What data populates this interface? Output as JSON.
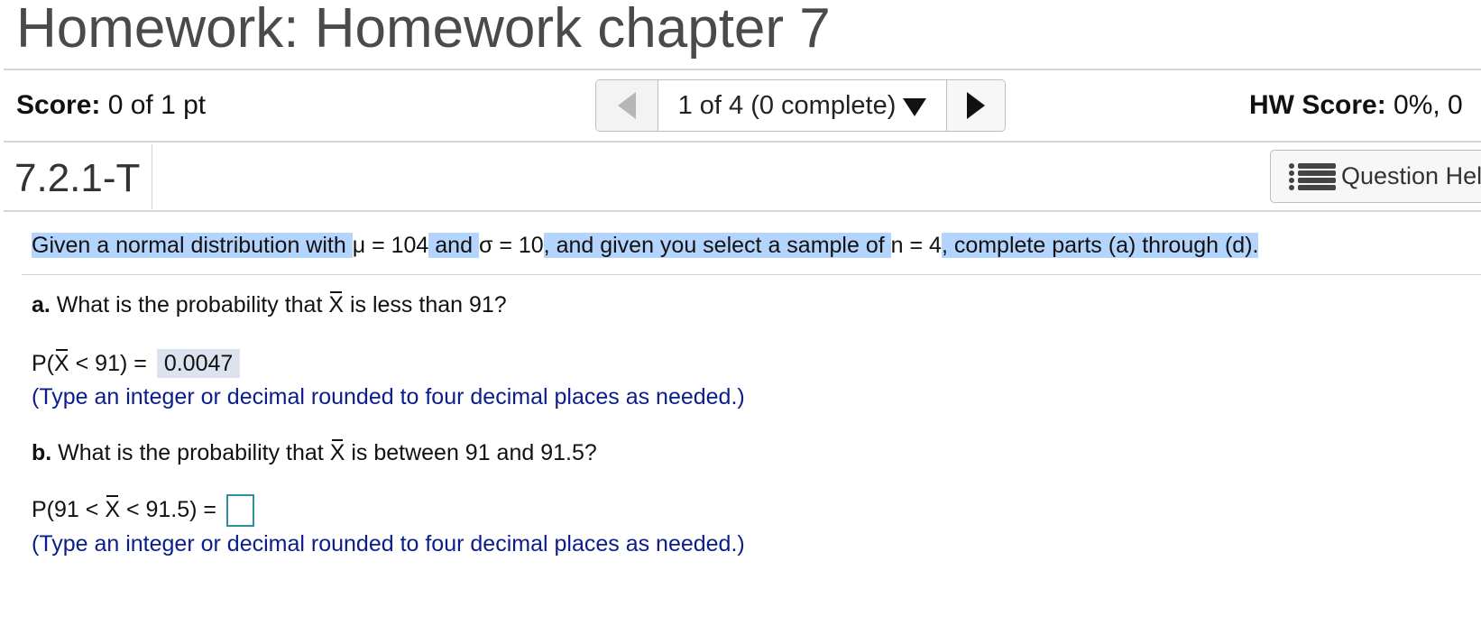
{
  "header": {
    "title": "Homework: Homework chapter 7"
  },
  "score_bar": {
    "score_label": "Score:",
    "score_value": "0 of 1 pt",
    "nav_position": "1 of 4 (0 complete)",
    "hw_score_label": "HW Score:",
    "hw_score_value": "0%, 0"
  },
  "question": {
    "id": "7.2.1-T",
    "help_label": "Question Hel"
  },
  "problem": {
    "seg1": "Given a normal distribution with ",
    "mu": "μ = 104",
    "seg2": " and ",
    "sigma": "σ = 10",
    "seg3": ", and given you select a sample of ",
    "n": "n = 4",
    "seg4": ", complete parts (a) through (d)."
  },
  "part_a": {
    "letter": "a.",
    "text_pre": " What is the probability that ",
    "xbar": "X",
    "text_post": " is less than 91?",
    "eq_pre": "P(",
    "eq_xbar": "X",
    "eq_post": " < 91) = ",
    "answer": "0.0047",
    "hint": "(Type an integer or decimal rounded to four decimal places as needed.)"
  },
  "part_b": {
    "letter": "b.",
    "text_pre": " What is the probability that ",
    "xbar": "X",
    "text_post": " is between 91 and 91.5?",
    "eq_pre": "P(91 < ",
    "eq_xbar": "X",
    "eq_post": " < 91.5) = ",
    "answer": "",
    "hint": "(Type an integer or decimal rounded to four decimal places as needed.)"
  },
  "colors": {
    "selection_highlight": "#b3d4fc",
    "hint_text": "#0b1d8c",
    "answer_bg": "#dde3ee",
    "input_border": "#2a8f9e"
  }
}
